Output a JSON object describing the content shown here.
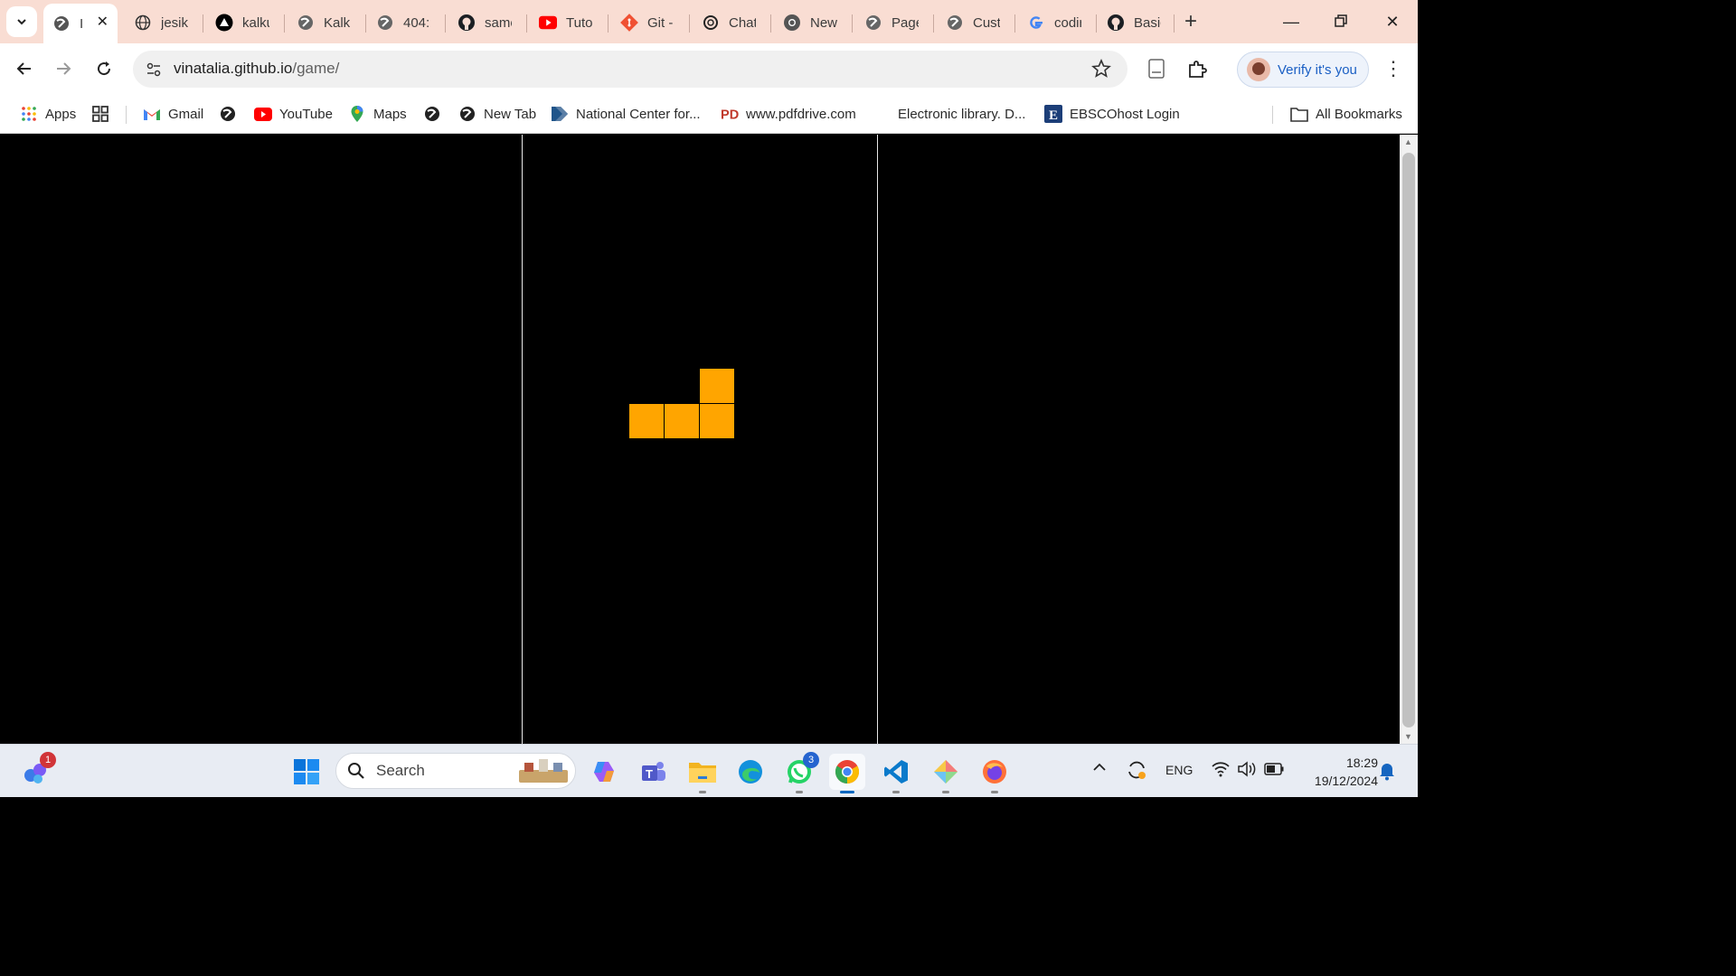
{
  "tabs": [
    {
      "title": "I",
      "active": true
    },
    {
      "title": "jesika"
    },
    {
      "title": "kalku"
    },
    {
      "title": "Kalku"
    },
    {
      "title": "404:"
    },
    {
      "title": "samo"
    },
    {
      "title": "Tutor"
    },
    {
      "title": "Git -"
    },
    {
      "title": "Chat"
    },
    {
      "title": "New"
    },
    {
      "title": "Page"
    },
    {
      "title": "Custo"
    },
    {
      "title": "codir"
    },
    {
      "title": "Basic"
    }
  ],
  "address": {
    "host": "vinatalia.github.io",
    "path": "/game/"
  },
  "profile": {
    "label": "Verify it's you"
  },
  "bookmarks": {
    "apps": "Apps",
    "gmail": "Gmail",
    "youtube": "YouTube",
    "maps": "Maps",
    "newtab": "New Tab",
    "ncbi": "National Center for...",
    "pdfdrive": "www.pdfdrive.com",
    "elibrary": "Electronic library. D...",
    "ebsco": "EBSCOhost Login",
    "all": "All Bookmarks"
  },
  "game": {
    "piece_color": "#ffa500",
    "piece": "L-tetromino"
  },
  "taskbar": {
    "search_placeholder": "Search",
    "widgets_badge": "1",
    "whatsapp_badge": "3",
    "lang": "ENG",
    "time": "18:29",
    "date": "19/12/2024"
  }
}
